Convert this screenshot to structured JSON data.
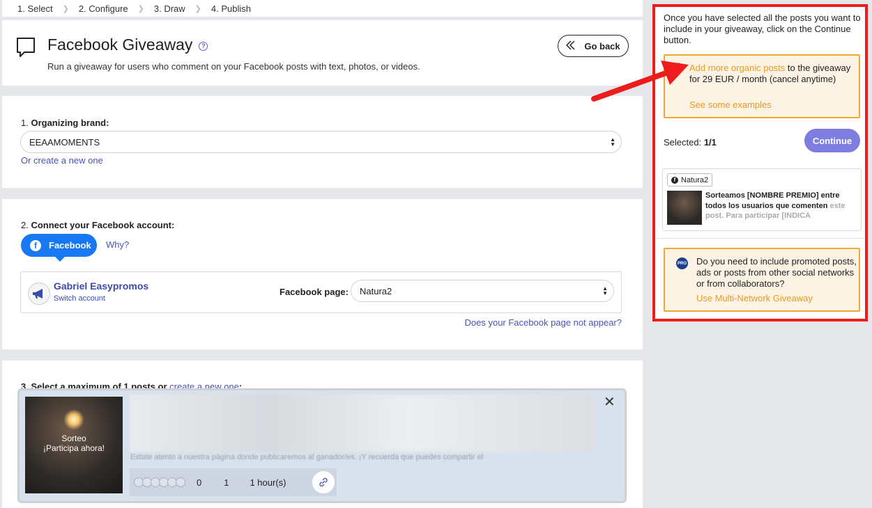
{
  "steps": [
    "1. Select",
    "2. Configure",
    "3. Draw",
    "4. Publish"
  ],
  "header": {
    "title": "Facebook Giveaway",
    "help": "?",
    "subtitle": "Run a giveaway for users who comment on your Facebook posts with text, photos, or videos.",
    "go_back": "Go back"
  },
  "brand": {
    "label_num": "1.",
    "label": "Organizing brand:",
    "value": "EEAAMOMENTS",
    "create_link": "Or create a new one"
  },
  "connect": {
    "label_num": "2.",
    "label": "Connect your Facebook account:",
    "fb_button": "Facebook",
    "why": "Why?",
    "account_name": "Gabriel Easypromos",
    "switch": "Switch account",
    "page_label": "Facebook page:",
    "page_value": "Natura2",
    "not_appear": "Does your Facebook page not appear?"
  },
  "posts": {
    "label_prefix": "3. Select a maximum of 1 posts or",
    "label_link": "create a new one",
    "label_suffix": ":",
    "thumb_line1": "Sorteo",
    "thumb_line2": "¡Participa ahora!",
    "snippet": "Estate atento a nuestra página donde publicaremos al ganador/es. ¡Y recuerda que puedes compartir el",
    "count_a": "0",
    "count_b": "1",
    "time": "1 hour(s)"
  },
  "panel": {
    "intro": "Once you have selected all the posts you want to include in your giveaway, click on the Continue button.",
    "organic_link": "Add more organic posts",
    "organic_rest": " to the giveaway for 29 EUR / month (cancel anytime)",
    "examples": "See some examples",
    "selected_label": "Selected: ",
    "selected_value": "1/1",
    "continue": "Continue",
    "sel_page": "Natura2",
    "sel_text": "Sorteamos [NOMBRE PREMIO] entre todos los usuarios que comenten",
    "sel_text_fade": "este post. Para participar [INDICA",
    "pro_badge": "PRO",
    "pro_text": "Do you need to include promoted posts, ads or posts from other social networks or from collaborators?",
    "pro_link": "Use Multi-Network Giveaway"
  },
  "colors": {
    "accent": "#4a53b8",
    "facebook": "#1877f2",
    "continue": "#7d7ee0",
    "highlight_border": "#ee1c1c",
    "warn_border": "#f0a733",
    "warn_bg": "#fdf3e5"
  }
}
